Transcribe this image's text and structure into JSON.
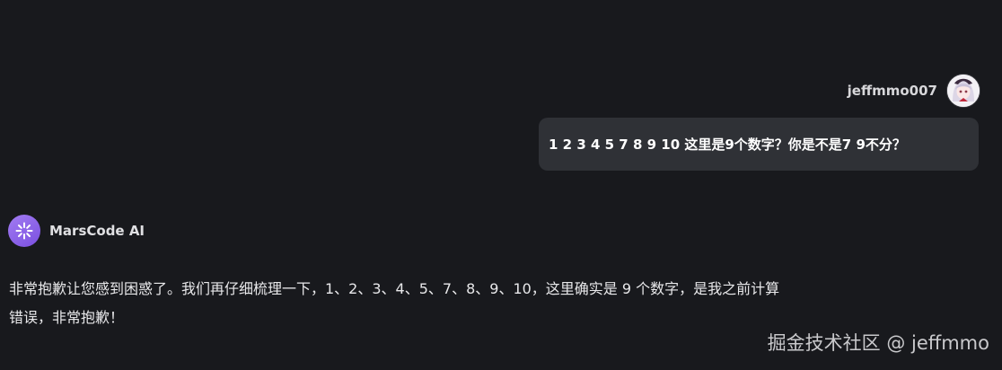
{
  "user": {
    "name": "jeffmmo007",
    "message": "1 2 3 4 5  7 8 9 10 这里是9个数字？你是不是7 9不分？"
  },
  "assistant": {
    "name": "MarsCode AI",
    "message_line1": "非常抱歉让您感到困惑了。我们再仔细梳理一下，1、2、3、4、5、7、8、9、10，这里确实是 9 个数字，是我之前计算",
    "message_line2": "错误，非常抱歉！"
  },
  "watermark": {
    "text": "掘金技术社区 @ jeffmmo"
  },
  "colors": {
    "background": "#18191d",
    "user_bubble": "#2f3136",
    "ai_avatar": "#8b5cf6"
  },
  "icons": {
    "user_avatar": "anime-avatar",
    "assistant_avatar": "marscode-spark-icon"
  }
}
